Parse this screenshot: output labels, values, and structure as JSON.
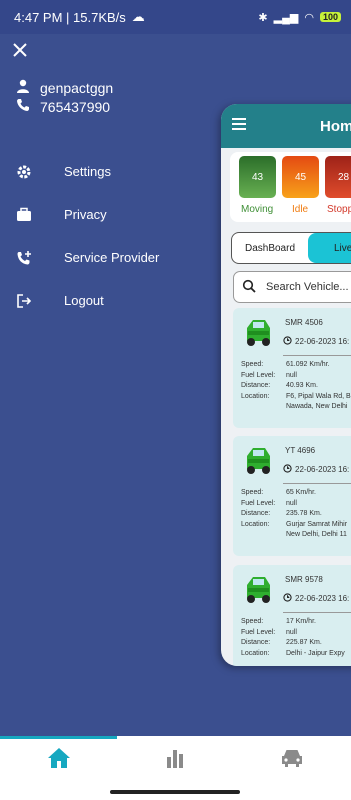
{
  "status": {
    "time": "4:47 PM | 15.7KB/s",
    "battery": "100"
  },
  "drawer": {
    "username": "genpactggn",
    "phone": "765437990",
    "menu": [
      {
        "label": "Settings",
        "icon": "gear-icon"
      },
      {
        "label": "Privacy",
        "icon": "briefcase-icon"
      },
      {
        "label": "Service Provider",
        "icon": "phone-add-icon"
      },
      {
        "label": "Logout",
        "icon": "logout-icon"
      }
    ]
  },
  "panel": {
    "title": "Hom",
    "stats": [
      {
        "value": "43",
        "label": "Moving",
        "color": "#3f8f36"
      },
      {
        "value": "45",
        "label": "Idle",
        "color": "#f07d12"
      },
      {
        "value": "28",
        "label": "Stopp",
        "color": "#d33a2b"
      }
    ],
    "toggle": {
      "left": "DashBoard",
      "right": "Live"
    },
    "search": {
      "placeholder": "Search Vehicle..."
    },
    "labels": {
      "speed": "Speed:",
      "fuel": "Fuel Level:",
      "distance": "Distance:",
      "location": "Location:"
    },
    "vehicles": [
      {
        "name": "SMR 4506",
        "date": "22-06-2023 16:",
        "speed": "61.092 Km/hr.",
        "fuel": "null",
        "distance": "40.93 Km.",
        "location": "F6, Pipal Wala Rd, B\nNawada, New Delhi"
      },
      {
        "name": "YT 4696",
        "date": "22-06-2023 16:",
        "speed": "65 Km/hr.",
        "fuel": "null",
        "distance": "235.78 Km.",
        "location": "Gurjar Samrat Mihir\nNew Delhi, Delhi 11"
      },
      {
        "name": "SMR 9578",
        "date": "22-06-2023 16:",
        "speed": "17 Km/hr.",
        "fuel": "null",
        "distance": "225.87 Km.",
        "location": "Delhi - Jaipur Expy"
      }
    ]
  },
  "colors": {
    "drawer_bg": "#3b4f8f",
    "appbar": "#23808a",
    "accent": "#16a8c0"
  }
}
